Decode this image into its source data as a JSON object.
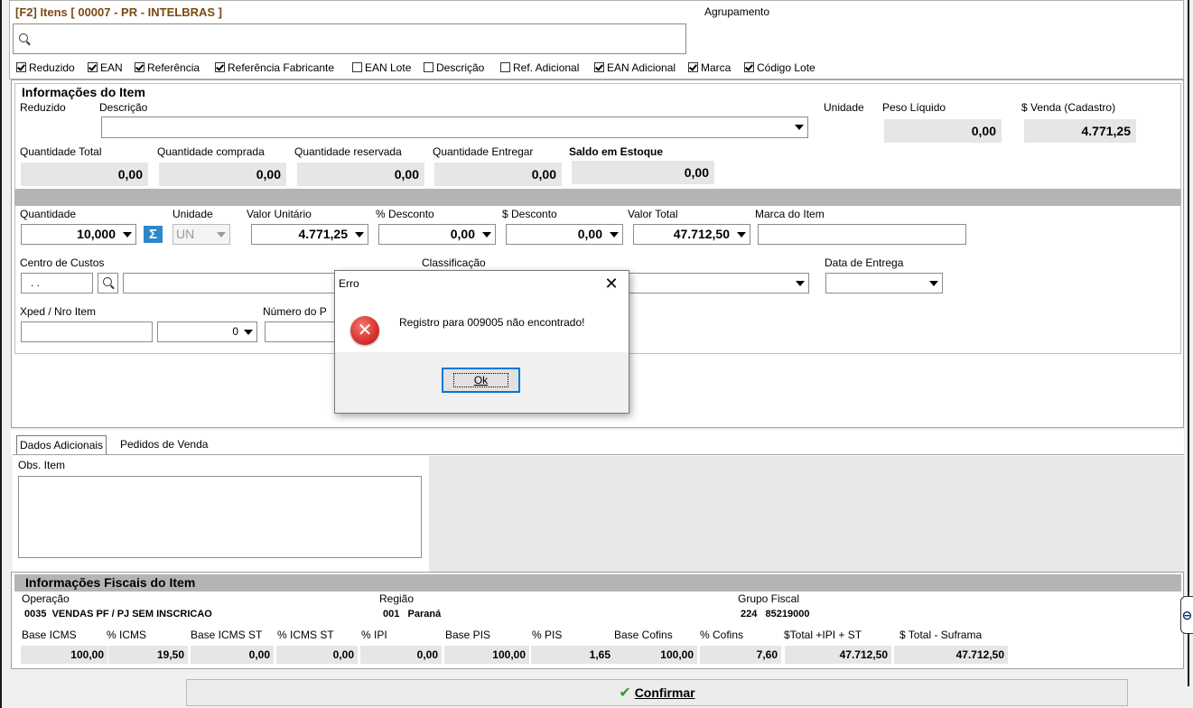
{
  "window": {
    "title": "[F2] Itens [ 00007 - PR - INTELBRAS ]",
    "grouping_label": "Agrupamento"
  },
  "search": {
    "placeholder": ""
  },
  "filters": [
    {
      "label": "Reduzido",
      "checked": true
    },
    {
      "label": "EAN",
      "checked": true
    },
    {
      "label": "Referência",
      "checked": true
    },
    {
      "label": "Referência Fabricante",
      "checked": true
    },
    {
      "label": "EAN Lote",
      "checked": false
    },
    {
      "label": "Descrição",
      "checked": false
    },
    {
      "label": "Ref. Adicional",
      "checked": false
    },
    {
      "label": "EAN Adicional",
      "checked": true
    },
    {
      "label": "Marca",
      "checked": true
    },
    {
      "label": "Código Lote",
      "checked": true
    }
  ],
  "item_info": {
    "title": "Informações do Item",
    "reduzido_label": "Reduzido",
    "descricao_label": "Descrição",
    "unidade_label": "Unidade",
    "peso_liquido_label": "Peso Líquido",
    "peso_liquido_value": "0,00",
    "venda_cadastro_label": "$ Venda (Cadastro)",
    "venda_cadastro_value": "4.771,25",
    "qtd_total_label": "Quantidade Total",
    "qtd_total_value": "0,00",
    "qtd_comprada_label": "Quantidade comprada",
    "qtd_comprada_value": "0,00",
    "qtd_reservada_label": "Quantidade reservada",
    "qtd_reservada_value": "0,00",
    "qtd_entregar_label": "Quantidade Entregar",
    "qtd_entregar_value": "0,00",
    "saldo_label": "Saldo em Estoque",
    "saldo_value": "0,00"
  },
  "entry": {
    "quantidade_label": "Quantidade",
    "quantidade_value": "10,000",
    "unidade_label": "Unidade",
    "unidade_value": "UN",
    "valor_unit_label": "Valor Unitário",
    "valor_unit_value": "4.771,25",
    "pct_desc_label": "% Desconto",
    "pct_desc_value": "0,00",
    "desc_label": "$ Desconto",
    "desc_value": "0,00",
    "valor_total_label": "Valor Total",
    "valor_total_value": "47.712,50",
    "marca_label": "Marca do Item",
    "centro_label": "Centro de Custos",
    "centro_value": ". .",
    "classificacao_label": "Classificação",
    "data_entrega_label": "Data de Entrega",
    "xped_label": "Xped / Nro Item",
    "xped_num_value": "0",
    "numero_label": "Número do P"
  },
  "tabs": [
    {
      "label": "Dados Adicionais",
      "active": true
    },
    {
      "label": "Pedidos de Venda",
      "active": false
    }
  ],
  "obs_label": "Obs. Item",
  "fiscal": {
    "title": "Informações Fiscais do Item",
    "operacao_label": "Operação",
    "operacao_value": "0035  VENDAS PF / PJ SEM INSCRICAO",
    "regiao_label": "Região",
    "regiao_value": "001   Paraná",
    "grupo_label": "Grupo Fiscal",
    "grupo_value": "224   85219000",
    "cols": [
      {
        "label": "Base ICMS",
        "value": "100,00"
      },
      {
        "label": "% ICMS",
        "value": "19,50"
      },
      {
        "label": "Base ICMS ST",
        "value": "0,00"
      },
      {
        "label": "% ICMS ST",
        "value": "0,00"
      },
      {
        "label": "% IPI",
        "value": "0,00"
      },
      {
        "label": "Base PIS",
        "value": "100,00"
      },
      {
        "label": "% PIS",
        "value": "1,65"
      },
      {
        "label": "Base Cofins",
        "value": "100,00"
      },
      {
        "label": "% Cofins",
        "value": "7,60"
      },
      {
        "label": "$Total +IPI + ST",
        "value": "47.712,50"
      },
      {
        "label": "$ Total - Suframa",
        "value": "47.712,50"
      }
    ]
  },
  "confirm_label": "Confirmar",
  "dialog": {
    "title": "Erro",
    "message": "Registro para 009005 não encontrado!",
    "ok_label": "Ok"
  },
  "colors": {
    "title": "#7a4a12",
    "error": "#d9302c",
    "confirm_check": "#2e9e2e",
    "sigma": "#2f86c9"
  }
}
